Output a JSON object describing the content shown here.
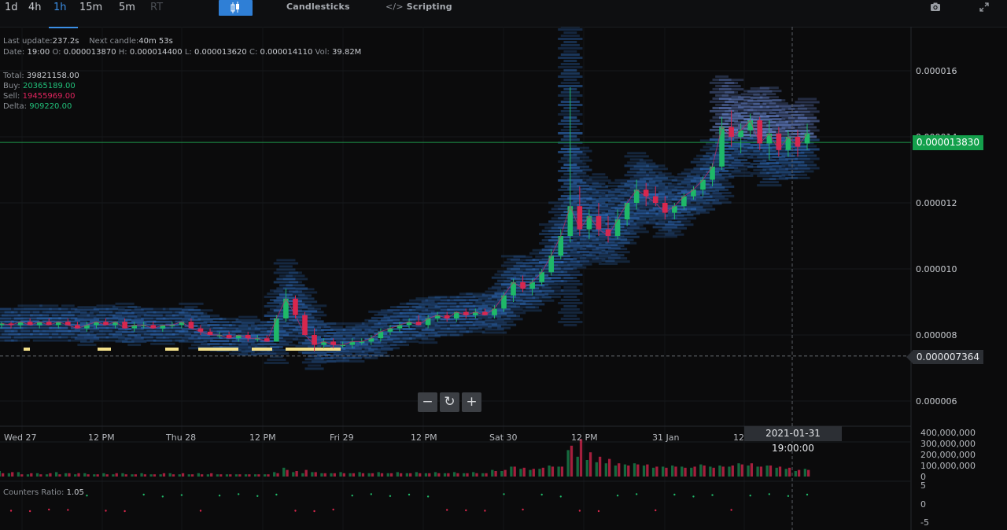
{
  "toolbar": {
    "timeframes": [
      {
        "label": "1d",
        "active": false,
        "dim": false
      },
      {
        "label": "4h",
        "active": false,
        "dim": false
      },
      {
        "label": "1h",
        "active": true,
        "dim": false
      },
      {
        "label": "15m",
        "active": false,
        "dim": false
      },
      {
        "label": "5m",
        "active": false,
        "dim": false
      },
      {
        "label": "RT",
        "active": false,
        "dim": true
      }
    ],
    "chart_type_icon": "candlestick-icon",
    "candlesticks_label": "Candlesticks",
    "scripting_label": "Scripting",
    "scripting_icon": "code-icon",
    "screenshot_icon": "camera-icon",
    "fullscreen_icon": "expand-icon"
  },
  "info": {
    "last_update_label": "Last update:",
    "last_update_value": "237.2s",
    "next_candle_label": "Next candle:",
    "next_candle_value": "40m 53s",
    "date_label": "Date:",
    "date_value": "19:00",
    "open_label": "O:",
    "open_value": "0.000013870",
    "high_label": "H:",
    "high_value": "0.000014400",
    "low_label": "L:",
    "low_value": "0.000013620",
    "close_label": "C:",
    "close_value": "0.000014110",
    "vol_label": "Vol:",
    "vol_value": "39.82M"
  },
  "stats": {
    "total_label": "Total:",
    "total_value": "39821158.00",
    "buy_label": "Buy:",
    "buy_value": "20365189.00",
    "sell_label": "Sell:",
    "sell_value": "19455969.00",
    "delta_label": "Delta:",
    "delta_value": "909220.00"
  },
  "price_axis": {
    "labels": [
      "0.000016",
      "0.000014",
      "0.000012",
      "0.000010",
      "0.000008",
      "0.000006"
    ],
    "current_price": "0.000013830",
    "crosshair_price": "0.000007364"
  },
  "time_axis": {
    "labels": [
      "Wed 27",
      "12 PM",
      "Thu 28",
      "12 PM",
      "Fri 29",
      "12 PM",
      "Sat 30",
      "12 PM",
      "31 Jan",
      "12"
    ],
    "crosshair_time": "2021-01-31 19:00:00"
  },
  "volume_axis": {
    "labels": [
      "400,000,000",
      "300,000,000",
      "200,000,000",
      "100,000,000",
      "0"
    ]
  },
  "counters": {
    "label": "Counters Ratio:",
    "value": "1.05",
    "axis_labels": [
      "5",
      "0",
      "-5"
    ]
  },
  "zoom": {
    "minus_label": "−",
    "reset_label": "↻",
    "plus_label": "+"
  },
  "colors": {
    "up": "#1fb868",
    "down": "#d8274d",
    "heatmap": "#2f6fc2",
    "heatmap_light": "#6e8fe0",
    "marker": "#f3e08a",
    "current_price": "#14a04c"
  },
  "chart_data": {
    "type": "candlestick",
    "timeframe": "1h",
    "price_ylim": [
      5.6e-06,
      1.7e-05
    ],
    "volume_ylim": [
      0,
      400000000
    ],
    "candles": [
      {
        "o": 8.3e-06,
        "h": 8.4e-06,
        "l": 8.2e-06,
        "c": 8.35e-06
      },
      {
        "o": 8.35e-06,
        "h": 8.4e-06,
        "l": 8.2e-06,
        "c": 8.3e-06
      },
      {
        "o": 8.3e-06,
        "h": 8.4e-06,
        "l": 8.2e-06,
        "c": 8.4e-06
      },
      {
        "o": 8.4e-06,
        "h": 8.5e-06,
        "l": 8.3e-06,
        "c": 8.3e-06
      },
      {
        "o": 8.3e-06,
        "h": 8.4e-06,
        "l": 8.2e-06,
        "c": 8.4e-06
      },
      {
        "o": 8.4e-06,
        "h": 8.5e-06,
        "l": 8.3e-06,
        "c": 8.3e-06
      },
      {
        "o": 8.3e-06,
        "h": 8.4e-06,
        "l": 8.2e-06,
        "c": 8.4e-06
      },
      {
        "o": 8.4e-06,
        "h": 8.5e-06,
        "l": 8.3e-06,
        "c": 8.3e-06
      },
      {
        "o": 8.3e-06,
        "h": 8.4e-06,
        "l": 8.2e-06,
        "c": 8.2e-06
      },
      {
        "o": 8.2e-06,
        "h": 8.4e-06,
        "l": 8.1e-06,
        "c": 8.3e-06
      },
      {
        "o": 8.3e-06,
        "h": 8.4e-06,
        "l": 8.2e-06,
        "c": 8.4e-06
      },
      {
        "o": 8.4e-06,
        "h": 8.5e-06,
        "l": 8.3e-06,
        "c": 8.3e-06
      },
      {
        "o": 8.3e-06,
        "h": 8.4e-06,
        "l": 8.2e-06,
        "c": 8.4e-06
      },
      {
        "o": 8.4e-06,
        "h": 8.5e-06,
        "l": 8.3e-06,
        "c": 8.2e-06
      },
      {
        "o": 8.2e-06,
        "h": 8.4e-06,
        "l": 8.1e-06,
        "c": 8.3e-06
      },
      {
        "o": 8.3e-06,
        "h": 8.4e-06,
        "l": 8.2e-06,
        "c": 8.3e-06
      },
      {
        "o": 8.3e-06,
        "h": 8.4e-06,
        "l": 8.2e-06,
        "c": 8.2e-06
      },
      {
        "o": 8.2e-06,
        "h": 8.3e-06,
        "l": 8.1e-06,
        "c": 8.3e-06
      },
      {
        "o": 8.3e-06,
        "h": 8.4e-06,
        "l": 8.2e-06,
        "c": 8.3e-06
      },
      {
        "o": 8.3e-06,
        "h": 8.4e-06,
        "l": 8.2e-06,
        "c": 8.4e-06
      },
      {
        "o": 8.4e-06,
        "h": 8.5e-06,
        "l": 8.2e-06,
        "c": 8.2e-06
      },
      {
        "o": 8.2e-06,
        "h": 8.3e-06,
        "l": 8e-06,
        "c": 8.1e-06
      },
      {
        "o": 8.1e-06,
        "h": 8.2e-06,
        "l": 8e-06,
        "c": 8e-06
      },
      {
        "o": 8e-06,
        "h": 8.1e-06,
        "l": 7.9e-06,
        "c": 8e-06
      },
      {
        "o": 8e-06,
        "h": 8.1e-06,
        "l": 7.9e-06,
        "c": 7.9e-06
      },
      {
        "o": 7.9e-06,
        "h": 8e-06,
        "l": 7.8e-06,
        "c": 8e-06
      },
      {
        "o": 8e-06,
        "h": 8.1e-06,
        "l": 7.8e-06,
        "c": 7.9e-06
      },
      {
        "o": 7.9e-06,
        "h": 8e-06,
        "l": 7.8e-06,
        "c": 7.9e-06
      },
      {
        "o": 7.9e-06,
        "h": 8e-06,
        "l": 7.8e-06,
        "c": 7.8e-06
      },
      {
        "o": 7.8e-06,
        "h": 8.6e-06,
        "l": 7.8e-06,
        "c": 8.5e-06
      },
      {
        "o": 8.5e-06,
        "h": 9.4e-06,
        "l": 8.4e-06,
        "c": 9.1e-06
      },
      {
        "o": 9.1e-06,
        "h": 9.2e-06,
        "l": 8.5e-06,
        "c": 8.6e-06
      },
      {
        "o": 8.6e-06,
        "h": 8.7e-06,
        "l": 8e-06,
        "c": 8e-06
      },
      {
        "o": 8e-06,
        "h": 8.2e-06,
        "l": 7.5e-06,
        "c": 7.7e-06
      },
      {
        "o": 7.7e-06,
        "h": 7.9e-06,
        "l": 7.6e-06,
        "c": 7.8e-06
      },
      {
        "o": 7.8e-06,
        "h": 7.9e-06,
        "l": 7.6e-06,
        "c": 7.7e-06
      },
      {
        "o": 7.7e-06,
        "h": 7.8e-06,
        "l": 7.6e-06,
        "c": 7.7e-06
      },
      {
        "o": 7.7e-06,
        "h": 7.9e-06,
        "l": 7.6e-06,
        "c": 7.8e-06
      },
      {
        "o": 7.8e-06,
        "h": 7.9e-06,
        "l": 7.7e-06,
        "c": 7.8e-06
      },
      {
        "o": 7.8e-06,
        "h": 8e-06,
        "l": 7.7e-06,
        "c": 7.9e-06
      },
      {
        "o": 7.9e-06,
        "h": 8.2e-06,
        "l": 7.8e-06,
        "c": 8.1e-06
      },
      {
        "o": 8.1e-06,
        "h": 8.3e-06,
        "l": 8e-06,
        "c": 8.2e-06
      },
      {
        "o": 8.2e-06,
        "h": 8.4e-06,
        "l": 8.1e-06,
        "c": 8.3e-06
      },
      {
        "o": 8.3e-06,
        "h": 8.5e-06,
        "l": 8.2e-06,
        "c": 8.4e-06
      },
      {
        "o": 8.4e-06,
        "h": 8.6e-06,
        "l": 8.3e-06,
        "c": 8.3e-06
      },
      {
        "o": 8.3e-06,
        "h": 8.6e-06,
        "l": 8.2e-06,
        "c": 8.5e-06
      },
      {
        "o": 8.5e-06,
        "h": 8.7e-06,
        "l": 8.4e-06,
        "c": 8.6e-06
      },
      {
        "o": 8.6e-06,
        "h": 8.7e-06,
        "l": 8.4e-06,
        "c": 8.5e-06
      },
      {
        "o": 8.5e-06,
        "h": 8.7e-06,
        "l": 8.4e-06,
        "c": 8.7e-06
      },
      {
        "o": 8.7e-06,
        "h": 8.8e-06,
        "l": 8.5e-06,
        "c": 8.6e-06
      },
      {
        "o": 8.6e-06,
        "h": 8.8e-06,
        "l": 8.5e-06,
        "c": 8.7e-06
      },
      {
        "o": 8.7e-06,
        "h": 8.8e-06,
        "l": 8.6e-06,
        "c": 8.6e-06
      },
      {
        "o": 8.6e-06,
        "h": 8.9e-06,
        "l": 8.5e-06,
        "c": 8.8e-06
      },
      {
        "o": 8.8e-06,
        "h": 9.3e-06,
        "l": 8.7e-06,
        "c": 9.2e-06
      },
      {
        "o": 9.2e-06,
        "h": 9.7e-06,
        "l": 9e-06,
        "c": 9.6e-06
      },
      {
        "o": 9.6e-06,
        "h": 9.8e-06,
        "l": 9.3e-06,
        "c": 9.4e-06
      },
      {
        "o": 9.4e-06,
        "h": 9.7e-06,
        "l": 9.2e-06,
        "c": 9.6e-06
      },
      {
        "o": 9.6e-06,
        "h": 1e-05,
        "l": 9.5e-06,
        "c": 9.9e-06
      },
      {
        "o": 9.9e-06,
        "h": 1.06e-05,
        "l": 9.8e-06,
        "c": 1.04e-05
      },
      {
        "o": 1.04e-05,
        "h": 1.12e-05,
        "l": 1.03e-05,
        "c": 1.1e-05
      },
      {
        "o": 1.1e-05,
        "h": 1.55e-05,
        "l": 1.08e-05,
        "c": 1.19e-05
      },
      {
        "o": 1.19e-05,
        "h": 1.25e-05,
        "l": 1.1e-05,
        "c": 1.12e-05
      },
      {
        "o": 1.12e-05,
        "h": 1.18e-05,
        "l": 1.09e-05,
        "c": 1.16e-05
      },
      {
        "o": 1.16e-05,
        "h": 1.2e-05,
        "l": 1.1e-05,
        "c": 1.12e-05
      },
      {
        "o": 1.12e-05,
        "h": 1.16e-05,
        "l": 1.08e-05,
        "c": 1.1e-05
      },
      {
        "o": 1.1e-05,
        "h": 1.18e-05,
        "l": 1.09e-05,
        "c": 1.15e-05
      },
      {
        "o": 1.15e-05,
        "h": 1.19e-05,
        "l": 1.13e-05,
        "c": 1.2e-05
      },
      {
        "o": 1.2e-05,
        "h": 1.27e-05,
        "l": 1.18e-05,
        "c": 1.24e-05
      },
      {
        "o": 1.24e-05,
        "h": 1.26e-05,
        "l": 1.19e-05,
        "c": 1.22e-05
      },
      {
        "o": 1.22e-05,
        "h": 1.25e-05,
        "l": 1.19e-05,
        "c": 1.2e-05
      },
      {
        "o": 1.2e-05,
        "h": 1.22e-05,
        "l": 1.15e-05,
        "c": 1.17e-05
      },
      {
        "o": 1.17e-05,
        "h": 1.2e-05,
        "l": 1.15e-05,
        "c": 1.19e-05
      },
      {
        "o": 1.19e-05,
        "h": 1.23e-05,
        "l": 1.18e-05,
        "c": 1.22e-05
      },
      {
        "o": 1.22e-05,
        "h": 1.25e-05,
        "l": 1.21e-05,
        "c": 1.24e-05
      },
      {
        "o": 1.24e-05,
        "h": 1.28e-05,
        "l": 1.22e-05,
        "c": 1.27e-05
      },
      {
        "o": 1.27e-05,
        "h": 1.32e-05,
        "l": 1.25e-05,
        "c": 1.31e-05
      },
      {
        "o": 1.31e-05,
        "h": 1.46e-05,
        "l": 1.3e-05,
        "c": 1.43e-05
      },
      {
        "o": 1.43e-05,
        "h": 1.48e-05,
        "l": 1.37e-05,
        "c": 1.4e-05
      },
      {
        "o": 1.4e-05,
        "h": 1.44e-05,
        "l": 1.35e-05,
        "c": 1.42e-05
      },
      {
        "o": 1.42e-05,
        "h": 1.47e-05,
        "l": 1.4e-05,
        "c": 1.45e-05
      },
      {
        "o": 1.45e-05,
        "h": 1.46e-05,
        "l": 1.36e-05,
        "c": 1.38e-05
      },
      {
        "o": 1.38e-05,
        "h": 1.45e-05,
        "l": 1.33e-05,
        "c": 1.41e-05
      },
      {
        "o": 1.41e-05,
        "h": 1.43e-05,
        "l": 1.34e-05,
        "c": 1.36e-05
      },
      {
        "o": 1.36e-05,
        "h": 1.42e-05,
        "l": 1.34e-05,
        "c": 1.4e-05
      },
      {
        "o": 1.4e-05,
        "h": 1.42e-05,
        "l": 1.34e-05,
        "c": 1.37e-05
      },
      {
        "o": 1.38e-05,
        "h": 1.44e-05,
        "l": 1.36e-05,
        "c": 1.41e-05
      }
    ],
    "volume_series": [
      {
        "name": "Buy",
        "values": [
          0.5,
          0.3,
          0.4,
          0.2,
          0.3,
          0.2,
          0.4,
          0.3,
          0.2,
          0.3,
          0.2,
          0.3,
          0.2,
          0.3,
          0.2,
          0.3,
          0.2,
          0.2,
          0.3,
          0.2,
          0.2,
          0.3,
          0.2,
          0.2,
          0.2,
          0.2,
          0.2,
          0.2,
          0.2,
          0.4,
          0.8,
          0.4,
          0.3,
          0.4,
          0.3,
          0.3,
          0.4,
          0.3,
          0.4,
          0.3,
          0.4,
          0.3,
          0.4,
          0.3,
          0.4,
          0.3,
          0.4,
          0.3,
          0.4,
          0.3,
          0.4,
          0.3,
          0.6,
          0.5,
          0.9,
          0.7,
          0.6,
          0.7,
          1.0,
          0.9,
          2.4,
          1.8,
          1.5,
          1.3,
          1.2,
          1.0,
          1.1,
          1.2,
          1.0,
          0.8,
          0.9,
          1.0,
          0.9,
          0.8,
          1.1,
          0.9,
          1.0,
          0.9,
          1.2,
          1.0,
          0.9,
          1.0,
          0.8,
          0.7,
          0.5,
          0.7
        ]
      },
      {
        "name": "Sell",
        "values": [
          0.3,
          0.4,
          0.2,
          0.3,
          0.2,
          0.3,
          0.2,
          0.3,
          0.3,
          0.2,
          0.2,
          0.2,
          0.3,
          0.2,
          0.2,
          0.2,
          0.2,
          0.3,
          0.2,
          0.3,
          0.2,
          0.2,
          0.3,
          0.2,
          0.2,
          0.2,
          0.2,
          0.2,
          0.2,
          0.3,
          0.6,
          0.5,
          0.6,
          0.4,
          0.3,
          0.3,
          0.3,
          0.3,
          0.3,
          0.3,
          0.3,
          0.3,
          0.3,
          0.3,
          0.3,
          0.3,
          0.3,
          0.3,
          0.3,
          0.3,
          0.3,
          0.3,
          0.5,
          0.6,
          0.9,
          0.8,
          0.7,
          0.8,
          0.9,
          0.9,
          2.8,
          3.4,
          2.2,
          1.8,
          1.6,
          1.2,
          1.0,
          1.1,
          1.1,
          0.9,
          0.8,
          0.9,
          0.8,
          0.9,
          1.0,
          0.8,
          0.9,
          1.0,
          1.1,
          1.2,
          0.9,
          1.0,
          0.9,
          0.8,
          0.6,
          0.6
        ]
      }
    ]
  }
}
